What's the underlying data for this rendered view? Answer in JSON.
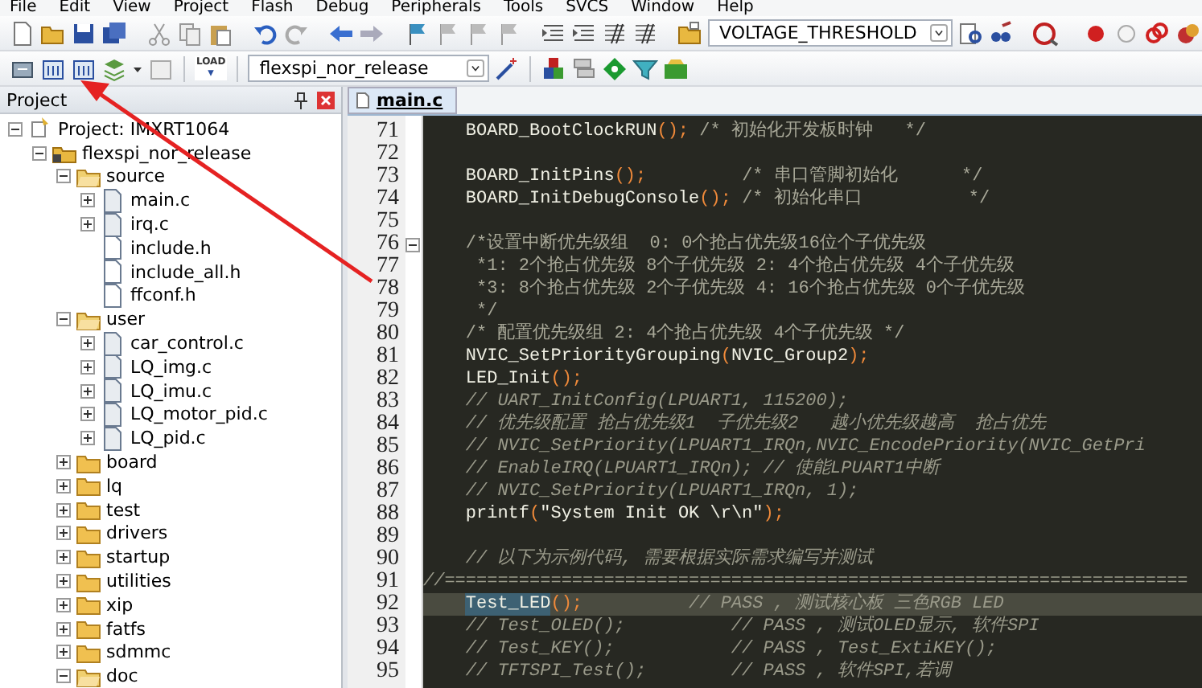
{
  "menu": [
    "File",
    "Edit",
    "View",
    "Project",
    "Flash",
    "Debug",
    "Peripherals",
    "Tools",
    "SVCS",
    "Window",
    "Help"
  ],
  "toolbar": {
    "define_combo": "VOLTAGE_THRESHOLD",
    "load_label": "LOAD",
    "target_combo": "flexspi_nor_release"
  },
  "project_panel": {
    "title": "Project",
    "tree": [
      {
        "label": "Project: IMXRT1064",
        "kind": "project",
        "expanded": true,
        "children": [
          {
            "label": "flexspi_nor_release",
            "kind": "target",
            "expanded": true,
            "children": [
              {
                "label": "source",
                "kind": "folder",
                "expanded": true,
                "children": [
                  {
                    "label": "main.c",
                    "kind": "file",
                    "expanded": false
                  },
                  {
                    "label": "irq.c",
                    "kind": "file",
                    "expanded": false
                  },
                  {
                    "label": "include.h",
                    "kind": "file"
                  },
                  {
                    "label": "include_all.h",
                    "kind": "file"
                  },
                  {
                    "label": "ffconf.h",
                    "kind": "file"
                  }
                ]
              },
              {
                "label": "user",
                "kind": "folder",
                "expanded": true,
                "children": [
                  {
                    "label": "car_control.c",
                    "kind": "file",
                    "expanded": false
                  },
                  {
                    "label": "LQ_img.c",
                    "kind": "file",
                    "expanded": false
                  },
                  {
                    "label": "LQ_imu.c",
                    "kind": "file",
                    "expanded": false
                  },
                  {
                    "label": "LQ_motor_pid.c",
                    "kind": "file",
                    "expanded": false
                  },
                  {
                    "label": "LQ_pid.c",
                    "kind": "file",
                    "expanded": false
                  }
                ]
              },
              {
                "label": "board",
                "kind": "folder",
                "expanded": false
              },
              {
                "label": "lq",
                "kind": "folder",
                "expanded": false
              },
              {
                "label": "test",
                "kind": "folder",
                "expanded": false
              },
              {
                "label": "drivers",
                "kind": "folder",
                "expanded": false
              },
              {
                "label": "startup",
                "kind": "folder",
                "expanded": false
              },
              {
                "label": "utilities",
                "kind": "folder",
                "expanded": false
              },
              {
                "label": "xip",
                "kind": "folder",
                "expanded": false
              },
              {
                "label": "fatfs",
                "kind": "folder",
                "expanded": false
              },
              {
                "label": "sdmmc",
                "kind": "folder",
                "expanded": false
              },
              {
                "label": "doc",
                "kind": "folder",
                "expanded": true
              }
            ]
          }
        ]
      }
    ]
  },
  "editor": {
    "tabs": [
      {
        "label": "main.c",
        "selected": true
      }
    ],
    "lines": [
      {
        "number": "71",
        "segments": [
          {
            "kind": "code",
            "text": "    BOARD_BootClockRUN"
          },
          {
            "kind": "punct",
            "text": "();"
          },
          {
            "kind": "comment",
            "text": " /* 初始化开发板时钟   */"
          }
        ]
      },
      {
        "number": "72"
      },
      {
        "number": "73",
        "segments": [
          {
            "kind": "code",
            "text": "    BOARD_InitPins"
          },
          {
            "kind": "punct",
            "text": "();"
          },
          {
            "kind": "comment",
            "text": "         /* 串口管脚初始化      */"
          }
        ]
      },
      {
        "number": "74",
        "segments": [
          {
            "kind": "code",
            "text": "    BOARD_InitDebugConsole"
          },
          {
            "kind": "punct",
            "text": "();"
          },
          {
            "kind": "comment",
            "text": " /* 初始化串口          */"
          }
        ]
      },
      {
        "number": "75"
      },
      {
        "number": "76",
        "fold": true,
        "segments": [
          {
            "kind": "comment",
            "text": "    /*设置中断优先级组  0: 0个抢占优先级16位个子优先级"
          }
        ]
      },
      {
        "number": "77",
        "segments": [
          {
            "kind": "comment",
            "text": "     *1: 2个抢占优先级 8个子优先级 2: 4个抢占优先级 4个子优先级"
          }
        ]
      },
      {
        "number": "78",
        "segments": [
          {
            "kind": "comment",
            "text": "     *3: 8个抢占优先级 2个子优先级 4: 16个抢占优先级 0个子优先级"
          }
        ]
      },
      {
        "number": "79",
        "segments": [
          {
            "kind": "comment",
            "text": "     */"
          }
        ]
      },
      {
        "number": "80",
        "segments": [
          {
            "kind": "comment",
            "text": "    /* 配置优先级组 2: 4个抢占优先级 4个子优先级 */"
          }
        ]
      },
      {
        "number": "81",
        "segments": [
          {
            "kind": "code",
            "text": "    NVIC_SetPriorityGrouping"
          },
          {
            "kind": "punct",
            "text": "("
          },
          {
            "kind": "code",
            "text": "NVIC_Group2"
          },
          {
            "kind": "punct",
            "text": ");"
          }
        ]
      },
      {
        "number": "82",
        "segments": [
          {
            "kind": "code",
            "text": "    LED_Init"
          },
          {
            "kind": "punct",
            "text": "();"
          }
        ]
      },
      {
        "number": "83",
        "segments": [
          {
            "kind": "line_comment",
            "text": "    // UART_InitConfig(LPUART1, 115200);"
          }
        ]
      },
      {
        "number": "84",
        "segments": [
          {
            "kind": "line_comment",
            "text": "    // 优先级配置 抢占优先级1  子优先级2   越小优先级越高  抢占优先"
          }
        ]
      },
      {
        "number": "85",
        "segments": [
          {
            "kind": "line_comment",
            "text": "    // NVIC_SetPriority(LPUART1_IRQn,NVIC_EncodePriority(NVIC_GetPri"
          }
        ]
      },
      {
        "number": "86",
        "segments": [
          {
            "kind": "line_comment",
            "text": "    // EnableIRQ(LPUART1_IRQn); // 使能LPUART1中断"
          }
        ]
      },
      {
        "number": "87",
        "segments": [
          {
            "kind": "line_comment",
            "text": "    // NVIC_SetPriority(LPUART1_IRQn, 1);"
          }
        ]
      },
      {
        "number": "88",
        "segments": [
          {
            "kind": "code",
            "text": "    printf"
          },
          {
            "kind": "punct",
            "text": "("
          },
          {
            "kind": "code",
            "text": "\"System Init OK \\r\\n\""
          },
          {
            "kind": "punct",
            "text": ");"
          }
        ]
      },
      {
        "number": "89"
      },
      {
        "number": "90",
        "segments": [
          {
            "kind": "line_comment",
            "text": "    // 以下为示例代码, 需要根据实际需求编写并测试"
          }
        ]
      },
      {
        "number": "91",
        "segments": [
          {
            "kind": "line_comment",
            "text": "//======================================================================"
          }
        ]
      },
      {
        "number": "92",
        "current": true,
        "segments": [
          {
            "kind": "selected",
            "text": "    Test_LED"
          },
          {
            "kind": "punct",
            "text": "();"
          },
          {
            "kind": "line_comment",
            "text": "          // PASS , 测试核心板 三色RGB LED"
          }
        ]
      },
      {
        "number": "93",
        "segments": [
          {
            "kind": "line_comment",
            "text": "    // Test_OLED();          // PASS , 测试OLED显示, 软件SPI"
          }
        ]
      },
      {
        "number": "94",
        "segments": [
          {
            "kind": "line_comment",
            "text": "    // Test_KEY();           // PASS , Test_ExtiKEY();"
          }
        ]
      },
      {
        "number": "95",
        "segments": [
          {
            "kind": "line_comment",
            "text": "    // TFTSPI_Test();        // PASS , 软件SPI,若调"
          }
        ]
      }
    ]
  }
}
